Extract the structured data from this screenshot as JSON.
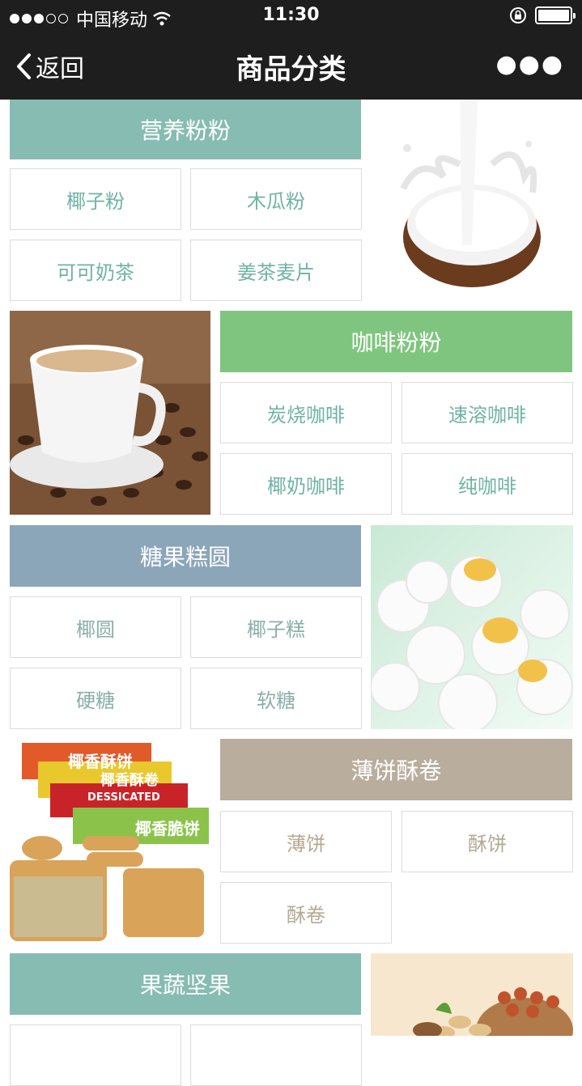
{
  "status": {
    "carrier": "中国移动",
    "time": "11:30"
  },
  "nav": {
    "back": "返回",
    "title": "商品分类"
  },
  "colors": {
    "teal": "#86bcb1",
    "green": "#80c57f",
    "blue": "#8ba5b9",
    "beige": "#b9ad9d"
  },
  "sections": [
    {
      "title": "营养粉粉",
      "items": [
        "椰子粉",
        "木瓜粉",
        "可可奶茶",
        "姜茶麦片"
      ]
    },
    {
      "title": "咖啡粉粉",
      "items": [
        "炭烧咖啡",
        "速溶咖啡",
        "椰奶咖啡",
        "纯咖啡"
      ]
    },
    {
      "title": "糖果糕圆",
      "items": [
        "椰圆",
        "椰子糕",
        "硬糖",
        "软糖"
      ]
    },
    {
      "title": "薄饼酥卷",
      "items": [
        "薄饼",
        "酥饼",
        "酥卷"
      ]
    },
    {
      "title": "果蔬坚果",
      "items": []
    }
  ],
  "photos": {
    "biscuit_brands": [
      "椰香酥饼",
      "椰香酥卷",
      "DESSICATED",
      "椰香脆饼"
    ]
  }
}
